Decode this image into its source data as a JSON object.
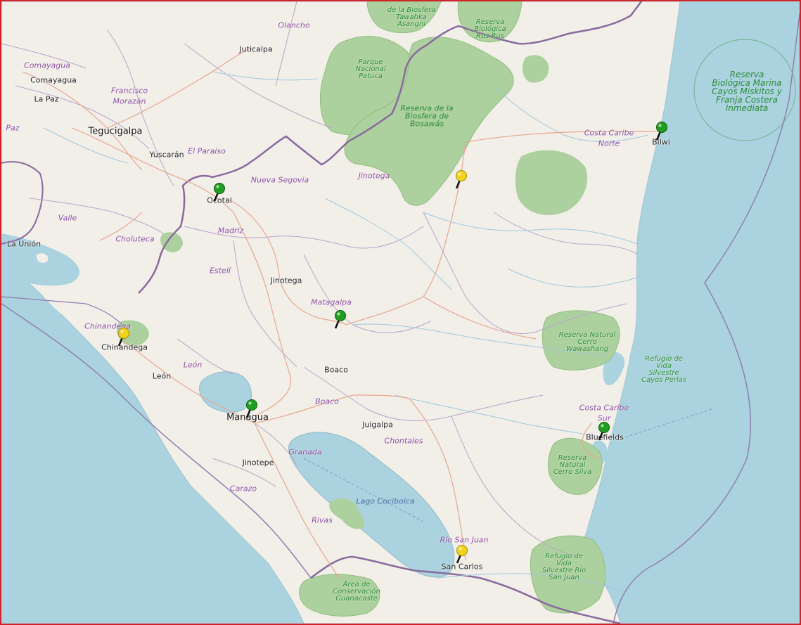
{
  "map": {
    "cities": [
      {
        "id": "juticalpa",
        "name": "Juticalpa"
      },
      {
        "id": "comayagua",
        "name": "Comayagua"
      },
      {
        "id": "la-paz",
        "name": "La Paz"
      },
      {
        "id": "tegucigalpa",
        "name": "Tegucigalpa"
      },
      {
        "id": "yuscaran",
        "name": "Yuscarán"
      },
      {
        "id": "ocotal",
        "name": "Ocotal"
      },
      {
        "id": "la-union",
        "name": "La Unión"
      },
      {
        "id": "jinotega",
        "name": "Jinotega"
      },
      {
        "id": "chinandega",
        "name": "Chinandega"
      },
      {
        "id": "leon",
        "name": "León"
      },
      {
        "id": "boaco",
        "name": "Boaco"
      },
      {
        "id": "managua",
        "name": "Managua"
      },
      {
        "id": "jinotepe",
        "name": "Jinotepe"
      },
      {
        "id": "juigalpa",
        "name": "Juigalpa"
      },
      {
        "id": "bilwi",
        "name": "Bilwi"
      },
      {
        "id": "bluefields",
        "name": "Bluefields"
      },
      {
        "id": "san-carlos",
        "name": "San Carlos"
      }
    ],
    "regions": [
      {
        "id": "olancho",
        "name": "Olancho"
      },
      {
        "id": "comayagua-dept",
        "name": "Comayagua"
      },
      {
        "id": "francisco-morazan-1",
        "name": "Francisco"
      },
      {
        "id": "francisco-morazan-2",
        "name": "Morazán"
      },
      {
        "id": "paz",
        "name": "Paz"
      },
      {
        "id": "el-paraiso",
        "name": "El Paraíso"
      },
      {
        "id": "nueva-segovia",
        "name": "Nueva Segovia"
      },
      {
        "id": "valle",
        "name": "Valle"
      },
      {
        "id": "madriz",
        "name": "Madriz"
      },
      {
        "id": "choluteca",
        "name": "Choluteca"
      },
      {
        "id": "esteli",
        "name": "Estelí"
      },
      {
        "id": "jinotega-dept",
        "name": "Jinotega"
      },
      {
        "id": "matagalpa",
        "name": "Matagalpa"
      },
      {
        "id": "chinandega-dept",
        "name": "Chinandega"
      },
      {
        "id": "leon-dept",
        "name": "León"
      },
      {
        "id": "boaco-dept",
        "name": "Boaco"
      },
      {
        "id": "granada",
        "name": "Granada"
      },
      {
        "id": "chontales",
        "name": "Chontales"
      },
      {
        "id": "carazo",
        "name": "Carazo"
      },
      {
        "id": "rivas",
        "name": "Rivas"
      },
      {
        "id": "rio-san-juan",
        "name": "Río San Juan"
      },
      {
        "id": "costa-caribe-norte-1",
        "name": "Costa Caribe"
      },
      {
        "id": "costa-caribe-norte-2",
        "name": "Norte"
      },
      {
        "id": "costa-caribe-sur-1",
        "name": "Costa Caribe"
      },
      {
        "id": "costa-caribe-sur-2",
        "name": "Sur"
      }
    ],
    "parks": [
      {
        "id": "tawahka",
        "name": "de la Biosfera Tawahka Asangni"
      },
      {
        "id": "rus-rus",
        "name": "Reserva Biológica Rus Rus"
      },
      {
        "id": "patuca",
        "name": "Parque Nacional Patuca"
      },
      {
        "id": "bosawas",
        "name": "Reserva de la Biosfera de Bosawás"
      },
      {
        "id": "wawashang",
        "name": "Reserva Natural Cerro Wawashang"
      },
      {
        "id": "cayos-perlas",
        "name": "Refugio de Vida Silvestre Cayos Perlas"
      },
      {
        "id": "cerro-silva",
        "name": "Reserva Natural Cerro Silva"
      },
      {
        "id": "rio-san-juan-refugio",
        "name": "Refugio de Vida Silvestre Río San Juan"
      },
      {
        "id": "guanacaste",
        "name": "Área de Conservación Guanacaste"
      },
      {
        "id": "miskitos",
        "name": "Reserva Biológica Marina Cayos Miskitos y Franja Costera Inmediata"
      }
    ],
    "water": [
      {
        "id": "cocibolca",
        "name": "Lago Cocibolca"
      }
    ],
    "markers": [
      {
        "id": "marker-ocotal",
        "status": "green"
      },
      {
        "id": "marker-bilwi",
        "status": "green"
      },
      {
        "id": "marker-matagalpa",
        "status": "green"
      },
      {
        "id": "marker-managua",
        "status": "green"
      },
      {
        "id": "marker-bluefields",
        "status": "green"
      },
      {
        "id": "marker-jinotega-east",
        "status": "yellow"
      },
      {
        "id": "marker-chinandega",
        "status": "yellow"
      },
      {
        "id": "marker-san-carlos",
        "status": "yellow"
      }
    ],
    "colors": {
      "frame_border": "#d2232a",
      "sea": "#aad3df",
      "land": "#f2efe9",
      "protected_area": "#add19e",
      "marker_green": "#1f9e1f",
      "marker_yellow": "#f2d21b"
    }
  }
}
